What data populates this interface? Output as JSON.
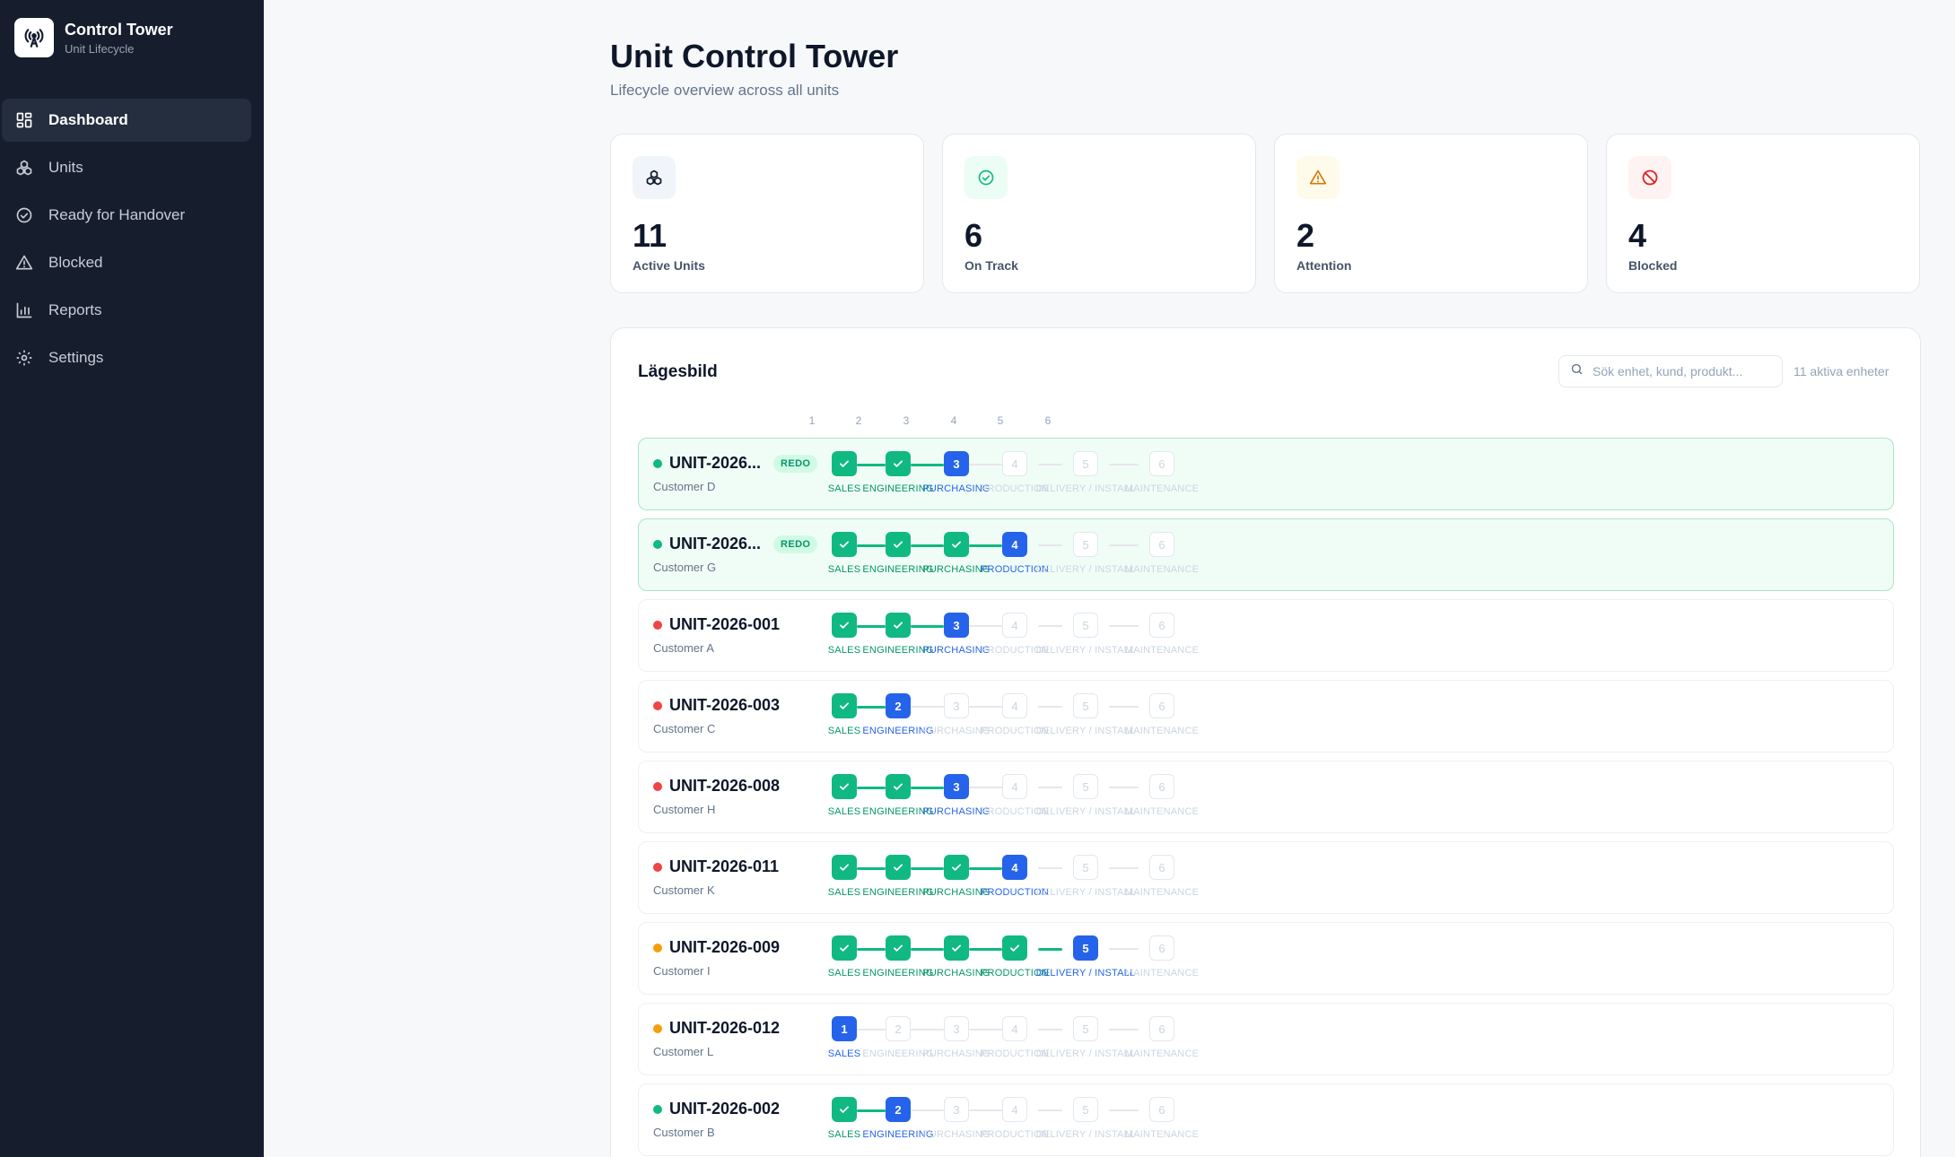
{
  "brand": {
    "title": "Control Tower",
    "subtitle": "Unit Lifecycle"
  },
  "nav": [
    {
      "label": "Dashboard",
      "icon": "dashboard-icon",
      "active": true
    },
    {
      "label": "Units",
      "icon": "units-icon",
      "active": false
    },
    {
      "label": "Ready for Handover",
      "icon": "check-circle-icon",
      "active": false
    },
    {
      "label": "Blocked",
      "icon": "warning-icon",
      "active": false
    },
    {
      "label": "Reports",
      "icon": "bar-chart-icon",
      "active": false
    },
    {
      "label": "Settings",
      "icon": "gear-icon",
      "active": false
    }
  ],
  "page": {
    "title": "Unit Control Tower",
    "subtitle": "Lifecycle overview across all units"
  },
  "stats": [
    {
      "value": "11",
      "label": "Active Units",
      "icon": "units-icon",
      "color": "#0f172a",
      "bg": "#f1f5f9"
    },
    {
      "value": "6",
      "label": "On Track",
      "icon": "check-circle-icon",
      "color": "#10b981",
      "bg": "#ecfdf5"
    },
    {
      "value": "2",
      "label": "Attention",
      "icon": "warning-icon",
      "color": "#d97706",
      "bg": "#fffbeb"
    },
    {
      "value": "4",
      "label": "Blocked",
      "icon": "blocked-icon",
      "color": "#dc2626",
      "bg": "#fef2f2"
    }
  ],
  "panel": {
    "title": "Lägesbild",
    "search_placeholder": "Sök enhet, kund, produkt...",
    "count_text": "11 aktiva enheter",
    "column_numbers": [
      "1",
      "2",
      "3",
      "4",
      "5",
      "6"
    ]
  },
  "stages": [
    "SALES",
    "ENGINEERING",
    "PURCHASING",
    "PRODUCTION",
    "DELIVERY / INSTALL",
    "MAINTENANCE"
  ],
  "colors": {
    "green": "#10b981",
    "blue": "#2563eb",
    "red": "#ef4444",
    "amber": "#f59e0b",
    "sidebar": "#161e2e"
  },
  "units": [
    {
      "id": "UNIT-2026...",
      "customer": "Customer D",
      "status": "green",
      "badge": "REDO",
      "current": 3
    },
    {
      "id": "UNIT-2026...",
      "customer": "Customer G",
      "status": "green",
      "badge": "REDO",
      "current": 4
    },
    {
      "id": "UNIT-2026-001",
      "customer": "Customer A",
      "status": "red",
      "badge": "",
      "current": 3
    },
    {
      "id": "UNIT-2026-003",
      "customer": "Customer C",
      "status": "red",
      "badge": "",
      "current": 2
    },
    {
      "id": "UNIT-2026-008",
      "customer": "Customer H",
      "status": "red",
      "badge": "",
      "current": 3
    },
    {
      "id": "UNIT-2026-011",
      "customer": "Customer K",
      "status": "red",
      "badge": "",
      "current": 4
    },
    {
      "id": "UNIT-2026-009",
      "customer": "Customer I",
      "status": "amber",
      "badge": "",
      "current": 5
    },
    {
      "id": "UNIT-2026-012",
      "customer": "Customer L",
      "status": "amber",
      "badge": "",
      "current": 1
    },
    {
      "id": "UNIT-2026-002",
      "customer": "Customer B",
      "status": "green",
      "badge": "",
      "current": 2
    }
  ]
}
